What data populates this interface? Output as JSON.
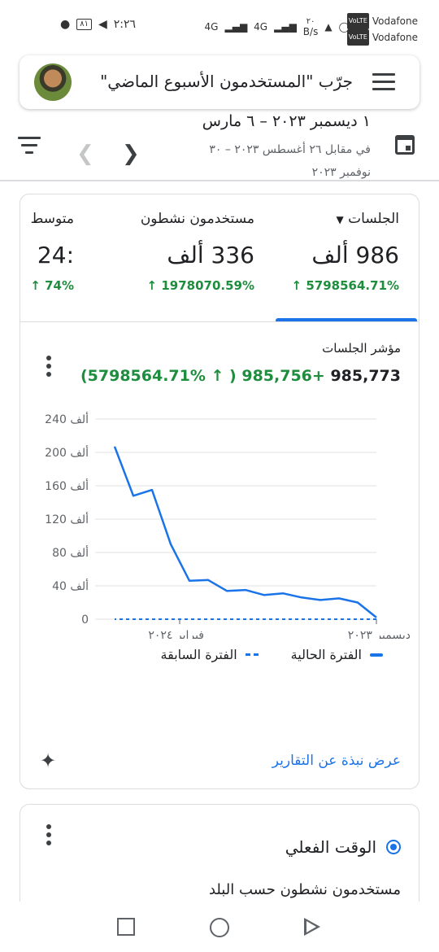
{
  "status_bar": {
    "carrier1": "Vodafone",
    "carrier2": "Vodafone",
    "volte_label": "VoLTE",
    "network1": "4G",
    "network2": "4G",
    "data_rate_value": "٢٠",
    "data_rate_unit": "B/s",
    "battery": "٨١",
    "time": "٢:٢٦"
  },
  "search": {
    "text": "جرّب \"المستخدمون الأسبوع الماضي\""
  },
  "date_range": {
    "main": "١ ديسمبر ٢٠٢٣ – ٦ مارس",
    "comparison": "في مقابل ٢٦ أغسطس ٢٠٢٣ – ٣٠ نوفمبر ٢٠٢٣"
  },
  "metrics": [
    {
      "label": "الجلسات",
      "value": "986 ألف",
      "change": "5798564.71% ↑"
    },
    {
      "label": "مستخدمون نشطون",
      "value": "336 ألف",
      "change": "1978070.59% ↑"
    },
    {
      "label": "متوسط",
      "value": ":24",
      "change": "74% ↑"
    }
  ],
  "chart_card": {
    "title": "مؤشر الجلسات",
    "summary_value": "985,773",
    "summary_change": "+985,756 ( ↑ 5798564.71%)",
    "insights_link": "عرض نبذة عن التقارير"
  },
  "chart_data": {
    "type": "line",
    "title": "مؤشر الجلسات",
    "x_labels": [
      "ديسمبر ٢٠٢٣",
      "فبراير ٢٠٢٤"
    ],
    "y_ticks": [
      "0",
      "40 ألف",
      "80 ألف",
      "120 ألف",
      "160 ألف",
      "200 ألف",
      "240 ألف"
    ],
    "ylim": [
      0,
      240000
    ],
    "series": [
      {
        "name": "الفترة الحالية",
        "style": "solid",
        "color": "#1a73e8",
        "values": [
          2000,
          20000,
          25000,
          23000,
          26000,
          31000,
          29000,
          35000,
          34000,
          47000,
          46000,
          90000,
          155000,
          148000,
          207000
        ]
      },
      {
        "name": "الفترة السابقة",
        "style": "dashed",
        "color": "#1a73e8",
        "values": [
          0,
          0,
          0,
          0,
          0,
          0,
          0,
          0,
          0,
          0,
          0,
          0,
          0,
          0,
          0
        ]
      }
    ],
    "grid": true,
    "legend_position": "bottom"
  },
  "realtime_card": {
    "title": "الوقت الفعلي",
    "subtitle": "مستخدمون نشطون حسب البلد"
  }
}
